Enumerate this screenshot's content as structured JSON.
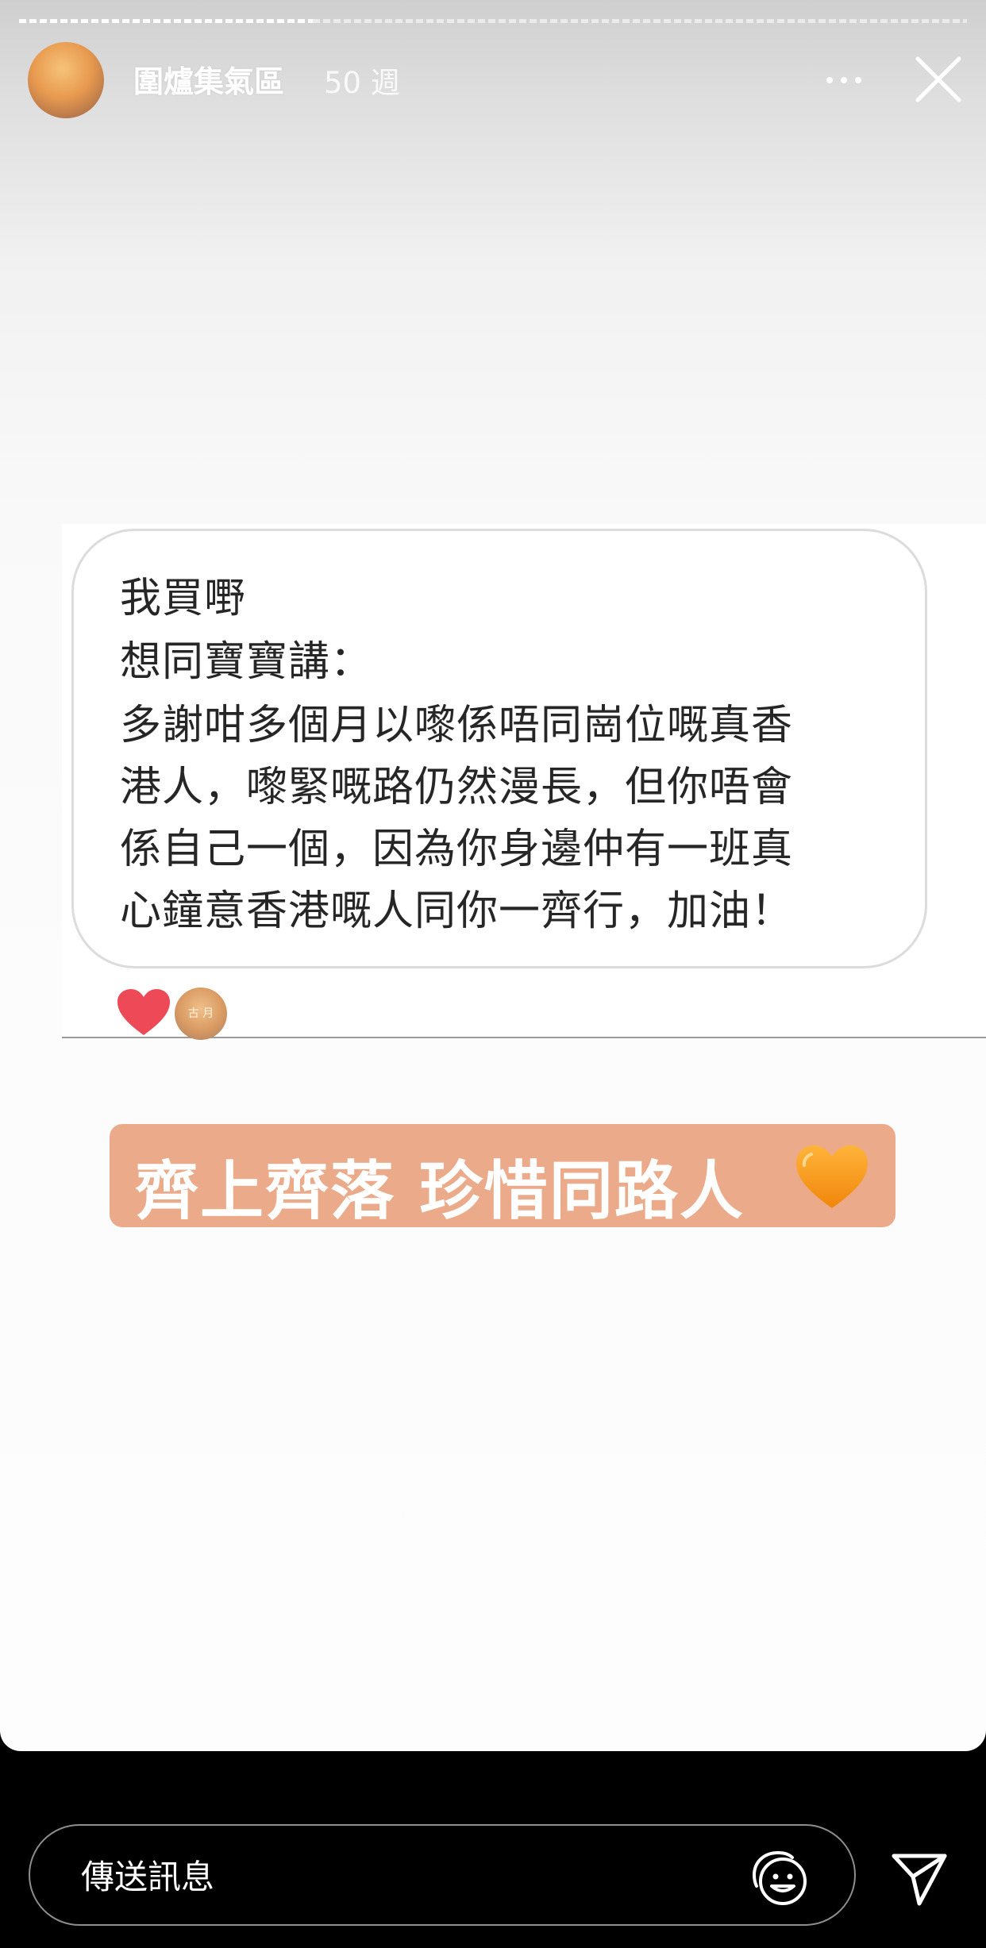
{
  "header": {
    "username": "圍爐集氣區",
    "timestamp": "50 週"
  },
  "progress": {
    "current_fraction": 0.31
  },
  "screenshot": {
    "message_lines": [
      "我買嘢",
      "想同寶寶講：",
      "多謝咁多個月以嚟係唔同崗位嘅真香",
      "港人，嚟緊嘅路仍然漫長，但你唔會",
      "係自己一個，因為你身邊仲有一班真",
      "心鐘意香港嘅人同你一齊行，加油！"
    ],
    "reaction_icon": "heart-icon",
    "reaction_color": "#ed4956",
    "reactor_avatar_text": "古 月"
  },
  "caption": {
    "text": "齊上齊落 珍惜同路人",
    "emoji_icon": "orange-heart-icon",
    "background": "#ebab8b"
  },
  "reply": {
    "placeholder": "傳送訊息",
    "sticker_icon": "sticker-icon",
    "send_icon": "send-icon"
  }
}
